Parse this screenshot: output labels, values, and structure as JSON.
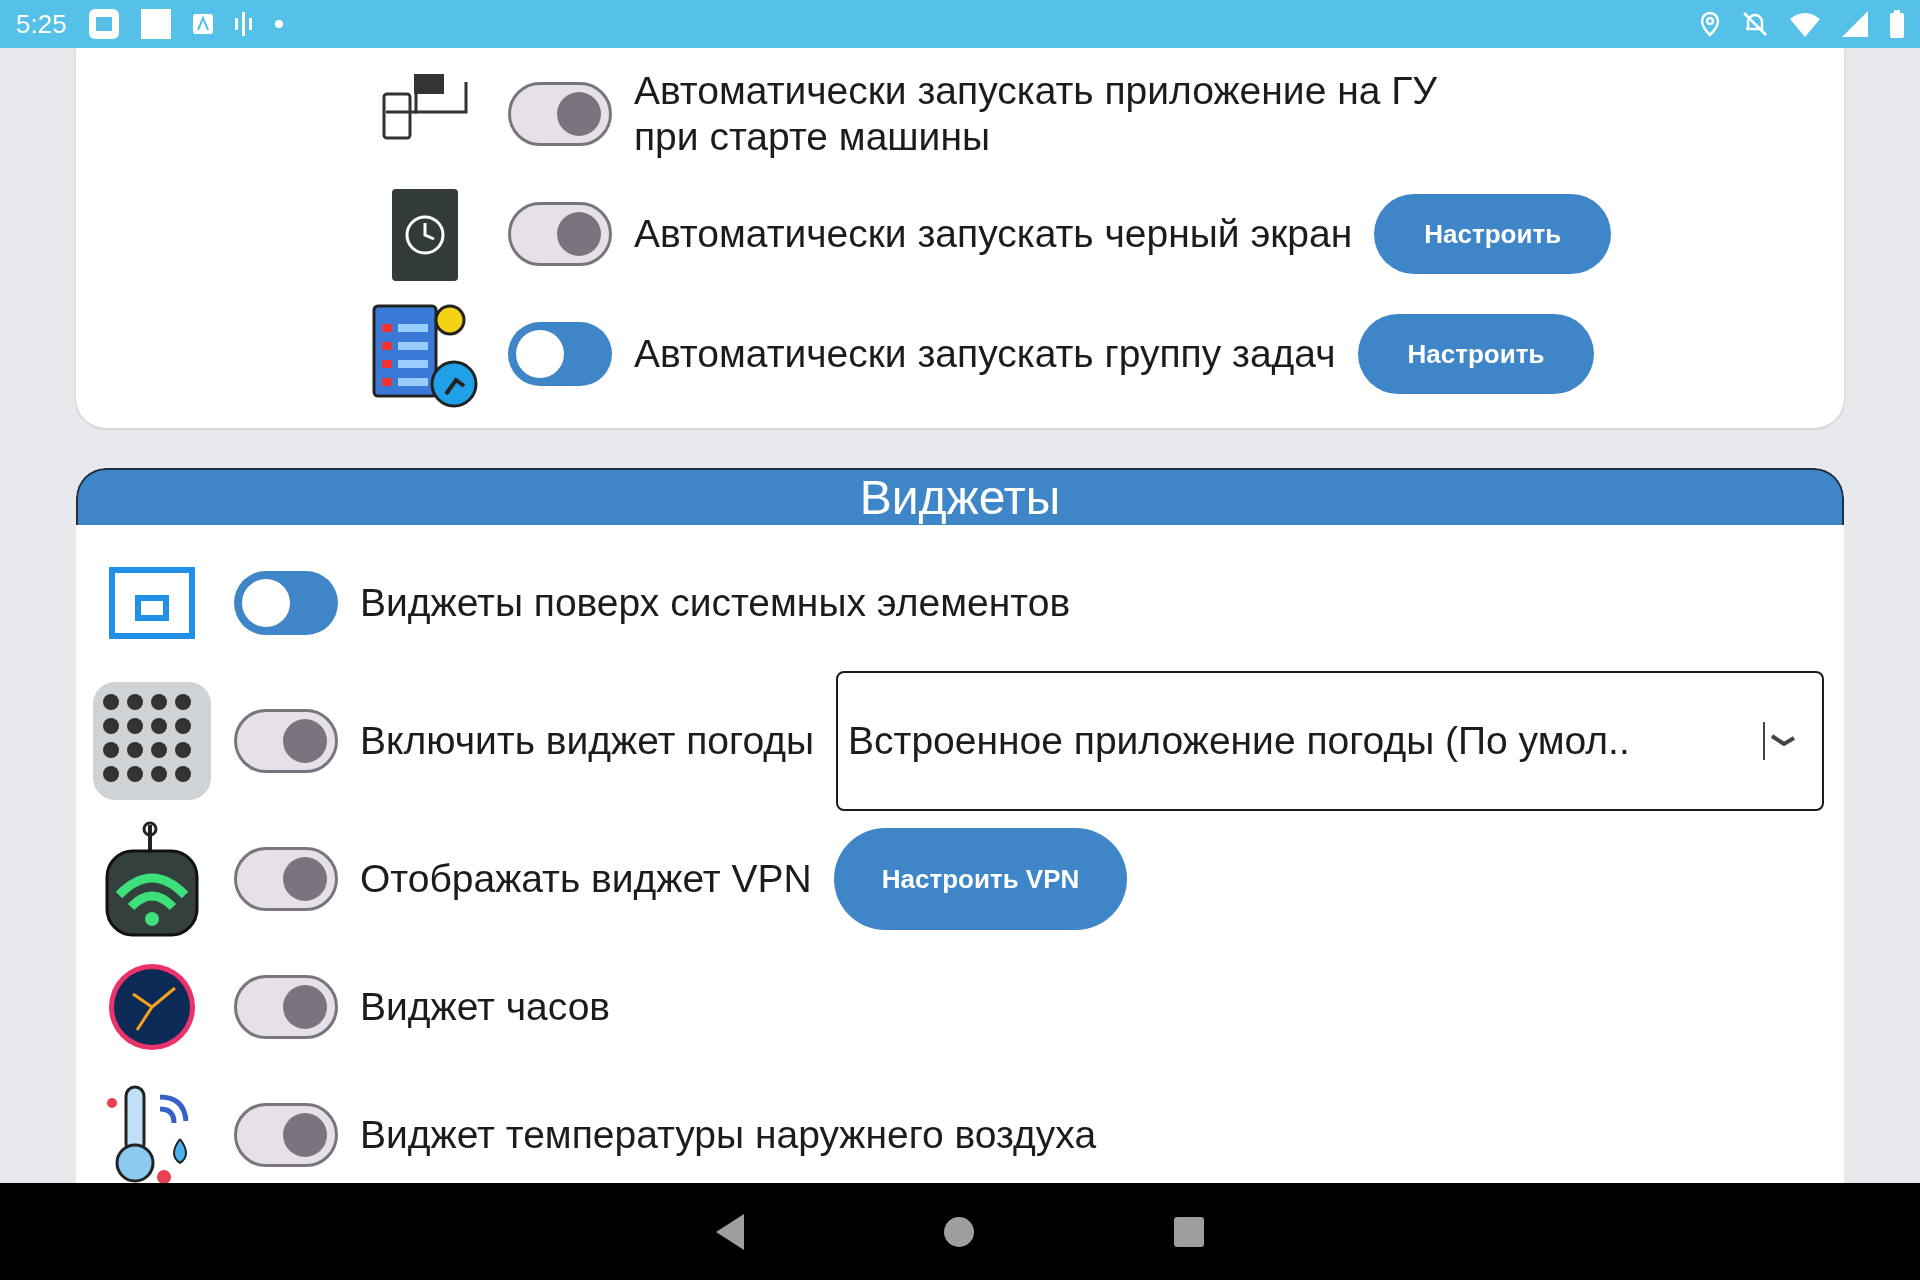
{
  "status_bar": {
    "time": "5:25"
  },
  "autostart": {
    "rows": [
      {
        "kind": "plain",
        "text": "Автоматически запускать приложение на ГУ при старте машины",
        "on": false
      },
      {
        "kind": "button",
        "text": "Автоматически запускать черный экран",
        "on": false,
        "button": "Настроить"
      },
      {
        "kind": "button",
        "text": "Автоматически запускать группу задач",
        "on": true,
        "button": "Настроить"
      }
    ]
  },
  "widgets": {
    "title": "Виджеты",
    "rows": [
      {
        "kind": "plain",
        "text": "Виджеты поверх системных элементов",
        "on": true
      },
      {
        "kind": "dropdown",
        "text": "Включить виджет погоды",
        "on": false,
        "dropdown": {
          "value": "Встроенное приложение погоды (По умол.."
        }
      },
      {
        "kind": "button",
        "text": "Отображать виджет VPN",
        "on": false,
        "button": "Настроить VPN"
      },
      {
        "kind": "plain",
        "text": "Виджет часов",
        "on": false
      },
      {
        "kind": "plain",
        "text": "Виджет температуры наружнего воздуха",
        "on": false
      }
    ]
  }
}
